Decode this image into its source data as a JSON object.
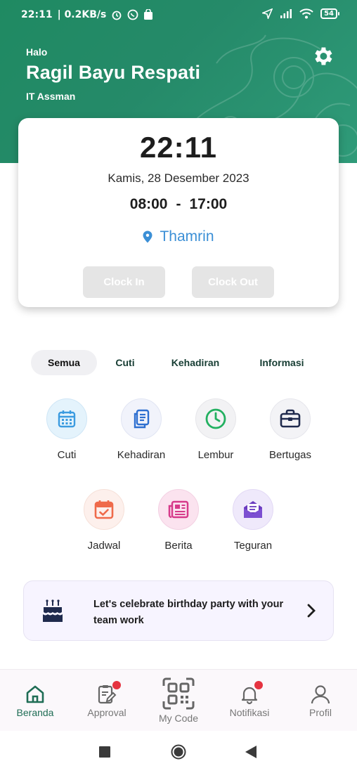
{
  "status_bar": {
    "time": "22:11",
    "speed": "| 0.2KB/s",
    "battery": "54"
  },
  "header": {
    "greeting": "Halo",
    "name": "Ragil Bayu Respati",
    "role": "IT Assman",
    "settings_icon": "gear-icon"
  },
  "attendance": {
    "time": "22:11",
    "date": "Kamis, 28 Desember 2023",
    "shift_start": "08:00",
    "shift_sep": "-",
    "shift_end": "17:00",
    "location": "Thamrin",
    "clock_in_label": "Clock In",
    "clock_out_label": "Clock Out"
  },
  "tabs": [
    {
      "label": "Semua",
      "active": true
    },
    {
      "label": "Cuti",
      "active": false
    },
    {
      "label": "Kehadiran",
      "active": false
    },
    {
      "label": "Informasi",
      "active": false
    }
  ],
  "menu": [
    {
      "label": "Cuti",
      "icon": "calendar-icon",
      "color": "#3b9be0"
    },
    {
      "label": "Kehadiran",
      "icon": "documents-icon",
      "color": "#2d6fd0"
    },
    {
      "label": "Lembur",
      "icon": "clock-icon",
      "color": "#22b060"
    },
    {
      "label": "Bertugas",
      "icon": "briefcase-icon",
      "color": "#1f2a4d"
    },
    {
      "label": "Jadwal",
      "icon": "calendar-check-icon",
      "color": "#ef6a4a"
    },
    {
      "label": "Berita",
      "icon": "newspaper-icon",
      "color": "#d63a8a"
    },
    {
      "label": "Teguran",
      "icon": "mail-open-icon",
      "color": "#6a3bbf"
    }
  ],
  "banner": {
    "text": "Let's celebrate birthday party with your team work",
    "icon": "cake-icon"
  },
  "bottom_nav": [
    {
      "label": "Beranda",
      "icon": "home-icon",
      "active": true,
      "badge": false
    },
    {
      "label": "Approval",
      "icon": "clipboard-edit-icon",
      "active": false,
      "badge": true
    },
    {
      "label": "My Code",
      "icon": "qr-code-icon",
      "active": false,
      "badge": false
    },
    {
      "label": "Notifikasi",
      "icon": "bell-icon",
      "active": false,
      "badge": true
    },
    {
      "label": "Profil",
      "icon": "user-icon",
      "active": false,
      "badge": false
    }
  ],
  "colors": {
    "brand": "#1f8a62",
    "location": "#3b8fd6",
    "badge": "#e53340"
  }
}
